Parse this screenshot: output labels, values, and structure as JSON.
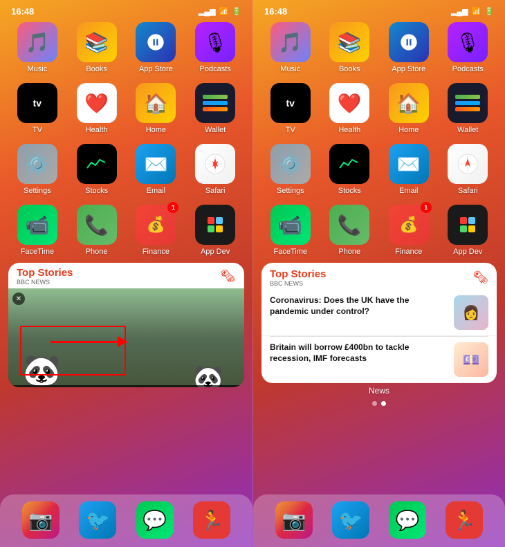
{
  "phones": [
    {
      "id": "left",
      "status_bar": {
        "time": "16:48",
        "signal": "▂▄▆",
        "wifi": "WiFi",
        "battery": "Battery"
      },
      "app_rows": [
        [
          {
            "name": "Music",
            "icon": "🎵",
            "bg": "bg-music"
          },
          {
            "name": "Books",
            "icon": "📚",
            "bg": "bg-books"
          },
          {
            "name": "App Store",
            "icon": "🅐",
            "bg": "bg-appstore"
          },
          {
            "name": "Podcasts",
            "icon": "🎙",
            "bg": "bg-podcasts"
          }
        ],
        [
          {
            "name": "TV",
            "icon": "📺",
            "bg": "bg-tv"
          },
          {
            "name": "Health",
            "icon": "❤️",
            "bg": "bg-health"
          },
          {
            "name": "Home",
            "icon": "🏠",
            "bg": "bg-home"
          },
          {
            "name": "Wallet",
            "icon": "💳",
            "bg": "bg-wallet"
          }
        ],
        [
          {
            "name": "Settings",
            "icon": "⚙️",
            "bg": "bg-settings"
          },
          {
            "name": "Stocks",
            "icon": "📈",
            "bg": "bg-stocks"
          },
          {
            "name": "Email",
            "icon": "✉️",
            "bg": "bg-email"
          },
          {
            "name": "Safari",
            "icon": "🧭",
            "bg": "bg-safari"
          }
        ],
        [
          {
            "name": "FaceTime",
            "icon": "📹",
            "bg": "bg-facetime"
          },
          {
            "name": "Phone",
            "icon": "📞",
            "bg": "bg-phone"
          },
          {
            "name": "Finance",
            "icon": "💰",
            "bg": "bg-finance",
            "badge": "1"
          },
          {
            "name": "App Dev",
            "icon": "⚡",
            "bg": "bg-appdev"
          }
        ]
      ],
      "widget": {
        "title": "Top Stories",
        "source": "BBC NEWS",
        "type": "video"
      },
      "dock": [
        {
          "name": "Instagram",
          "icon": "📷",
          "bg": "bg-finance"
        },
        {
          "name": "Twitter",
          "icon": "🐦",
          "bg": "bg-email"
        },
        {
          "name": "Messages",
          "icon": "💬",
          "bg": "bg-facetime"
        },
        {
          "name": "Fitness",
          "icon": "🏃",
          "bg": "bg-finance"
        }
      ]
    },
    {
      "id": "right",
      "status_bar": {
        "time": "16:48",
        "signal": "▂▄▆",
        "wifi": "WiFi",
        "battery": "Battery"
      },
      "app_rows": [
        [
          {
            "name": "Music",
            "icon": "🎵",
            "bg": "bg-music"
          },
          {
            "name": "Books",
            "icon": "📚",
            "bg": "bg-books"
          },
          {
            "name": "App Store",
            "icon": "🅐",
            "bg": "bg-appstore"
          },
          {
            "name": "Podcasts",
            "icon": "🎙",
            "bg": "bg-podcasts"
          }
        ],
        [
          {
            "name": "TV",
            "icon": "📺",
            "bg": "bg-tv"
          },
          {
            "name": "Health",
            "icon": "❤️",
            "bg": "bg-health"
          },
          {
            "name": "Home",
            "icon": "🏠",
            "bg": "bg-home"
          },
          {
            "name": "Wallet",
            "icon": "💳",
            "bg": "bg-wallet"
          }
        ],
        [
          {
            "name": "Settings",
            "icon": "⚙️",
            "bg": "bg-settings"
          },
          {
            "name": "Stocks",
            "icon": "📈",
            "bg": "bg-stocks"
          },
          {
            "name": "Email",
            "icon": "✉️",
            "bg": "bg-email"
          },
          {
            "name": "Safari",
            "icon": "🧭",
            "bg": "bg-safari"
          }
        ],
        [
          {
            "name": "FaceTime",
            "icon": "📹",
            "bg": "bg-facetime"
          },
          {
            "name": "Phone",
            "icon": "📞",
            "bg": "bg-phone"
          },
          {
            "name": "Finance",
            "icon": "💰",
            "bg": "bg-finance",
            "badge": "1"
          },
          {
            "name": "App Dev",
            "icon": "⚡",
            "bg": "bg-appdev"
          }
        ]
      ],
      "widget": {
        "title": "Top Stories",
        "source": "BBC NEWS",
        "type": "news",
        "items": [
          {
            "text": "Coronavirus: Does the UK have the pandemic under control?",
            "thumb_color": "#a8d8ea"
          },
          {
            "text": "Britain will borrow £400bn to tackle recession, IMF forecasts",
            "thumb_color": "#fcb69f"
          }
        ]
      },
      "news_label": "News",
      "dock": [
        {
          "name": "Instagram",
          "icon": "📷",
          "bg": "bg-finance"
        },
        {
          "name": "Twitter",
          "icon": "🐦",
          "bg": "bg-email"
        },
        {
          "name": "Messages",
          "icon": "💬",
          "bg": "bg-facetime"
        },
        {
          "name": "Fitness",
          "icon": "🏃",
          "bg": "bg-finance"
        }
      ]
    }
  ]
}
